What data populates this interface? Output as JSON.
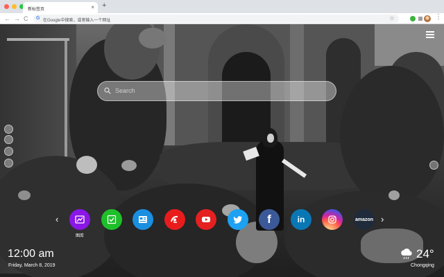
{
  "browser": {
    "tab_title": "新标签页",
    "tab_close_glyph": "×",
    "new_tab_glyph": "+",
    "back_glyph": "←",
    "forward_glyph": "→",
    "reload_glyph": "C",
    "address_placeholder": "在Google中搜索，或者输入一个网址",
    "google_glyph": "G",
    "star_glyph": "☆",
    "menu_glyph": "⋮",
    "traffic_lights": [
      "#ff5f57",
      "#febc2e",
      "#28c840"
    ]
  },
  "search": {
    "placeholder": "Search",
    "icon": "search-icon"
  },
  "apps": [
    {
      "name": "gallery",
      "label": "图库",
      "color": "#8a17e6",
      "icon": "image-icon"
    },
    {
      "name": "todo",
      "label": "",
      "color": "#1fbf2a",
      "icon": "check-icon"
    },
    {
      "name": "news",
      "label": "",
      "color": "#1a8fe0",
      "icon": "news-icon"
    },
    {
      "name": "chrome-web-store",
      "label": "",
      "color": "#e81c1c",
      "icon": "chrome-store-icon"
    },
    {
      "name": "youtube",
      "label": "",
      "color": "#e52020",
      "icon": "youtube-icon"
    },
    {
      "name": "twitter",
      "label": "",
      "color": "#1da1f2",
      "icon": "twitter-icon"
    },
    {
      "name": "facebook",
      "label": "",
      "color": "#3b5998",
      "icon": "facebook-icon",
      "glyph": "f"
    },
    {
      "name": "linkedin",
      "label": "",
      "color": "#0a77b5",
      "icon": "linkedin-icon",
      "glyph": "in"
    },
    {
      "name": "instagram",
      "label": "",
      "color": "#d6249f",
      "icon": "instagram-icon"
    },
    {
      "name": "amazon",
      "label": "",
      "color": "#1f2a3a",
      "icon": "amazon-icon",
      "glyph": "amazon"
    }
  ],
  "carousel": {
    "prev_glyph": "‹",
    "next_glyph": "›"
  },
  "clock": {
    "time": "12:00 am",
    "date": "Friday, March 8, 2019"
  },
  "weather": {
    "temperature": "24°",
    "city": "Chongqing",
    "icon": "cloud-rain-icon"
  }
}
